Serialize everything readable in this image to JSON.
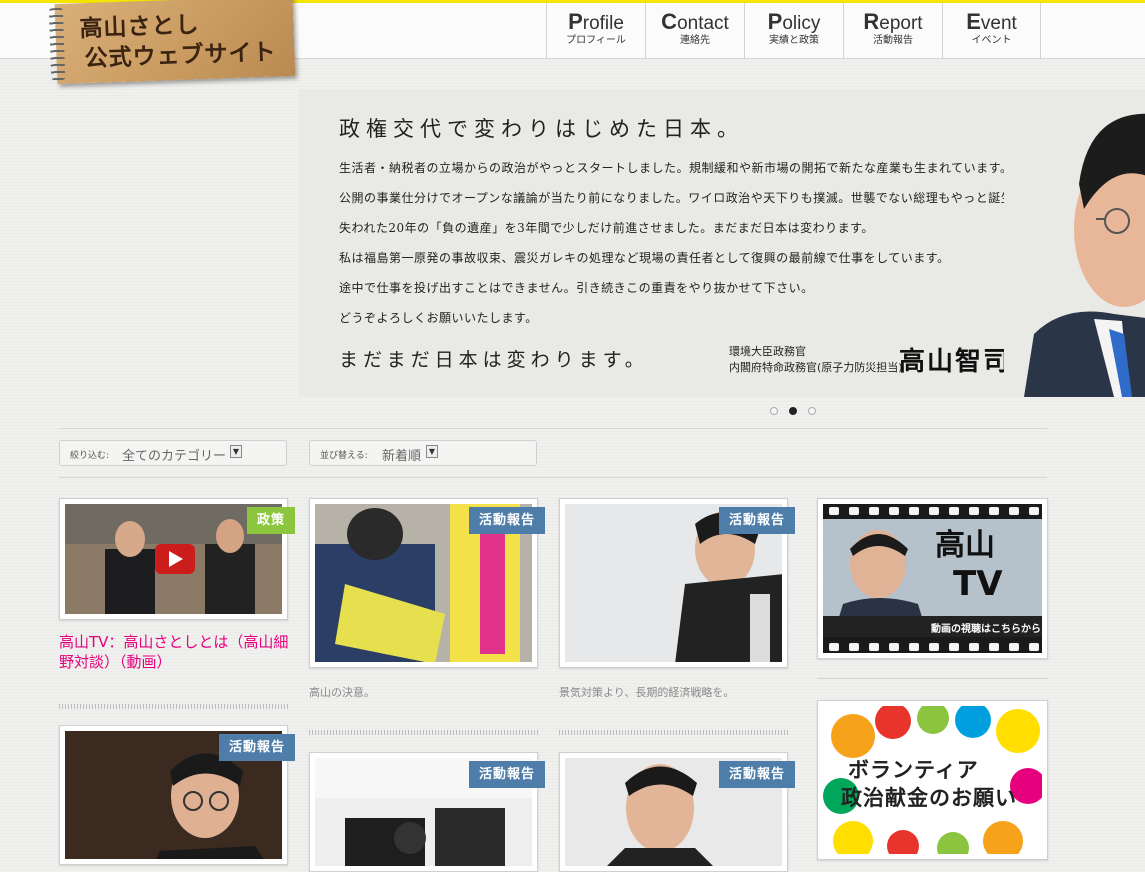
{
  "site": {
    "logo_line1": "高山さとし",
    "logo_line2": "公式ウェブサイト"
  },
  "nav": [
    {
      "first": "P",
      "rest": "rofile",
      "jp": "プロフィール"
    },
    {
      "first": "C",
      "rest": "ontact",
      "jp": "連絡先"
    },
    {
      "first": "P",
      "rest": "olicy",
      "jp": "実績と政策"
    },
    {
      "first": "R",
      "rest": "eport",
      "jp": "活動報告"
    },
    {
      "first": "E",
      "rest": "vent",
      "jp": "イベント"
    }
  ],
  "hero": {
    "heading": "政権交代で変わりはじめた日本。",
    "lines": [
      "生活者・納税者の立場からの政治がやっとスタートしました。規制緩和や新市場の開拓で新たな産業も生まれています。",
      "公開の事業仕分けでオープンな議論が当たり前になりました。ワイロ政治や天下りも撲滅。世襲でない総理もやっと誕生。",
      "失われた20年の「負の遺産」を3年間で少しだけ前進させました。まだまだ日本は変わります。",
      "私は福島第一原発の事故収束、震災ガレキの処理など現場の責任者として復興の最前線で仕事をしています。",
      "途中で仕事を投げ出すことはできません。引き続きこの重責をやり抜かせて下さい。",
      "どうぞよろしくお願いいたします。"
    ],
    "closing": "まだまだ日本は変わります。",
    "title1": "環境大臣政務官",
    "title2": "内閣府特命政務官(原子力防災担当)",
    "signature": "高山智司"
  },
  "filters": {
    "narrow_label": "絞り込む:",
    "narrow_value": "全てのカテゴリー",
    "sort_label": "並び替える:",
    "sort_value": "新着順"
  },
  "posts": [
    {
      "tag": "政策",
      "title": "高山TV：高山さとしとは（高山細野対談）（動画）"
    },
    {
      "tag": "活動報告",
      "caption": "高山の決意。"
    },
    {
      "tag": "活動報告",
      "caption": "景気対策より、長期的経済戦略を。"
    },
    {
      "tag": "活動報告"
    },
    {
      "tag": "活動報告"
    },
    {
      "tag": "活動報告"
    }
  ],
  "banners": {
    "tv_title_1": "高山",
    "tv_title_2": "TV",
    "tv_sub": "動画の視聴はこちらから",
    "donation_line1": "ボランティア",
    "donation_line2": "政治献金のお願い"
  },
  "colors": {
    "accent_yellow": "#f5e600",
    "policy_tag": "#8cc63f",
    "report_tag": "#4f7da9",
    "link_pink": "#e6007e"
  }
}
